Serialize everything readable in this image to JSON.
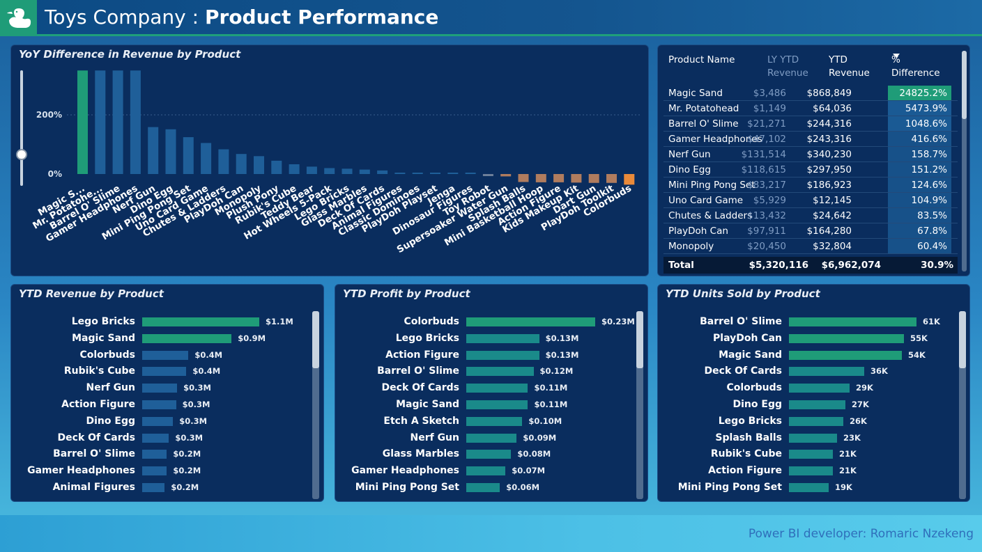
{
  "header": {
    "company": "Toys Company :",
    "page_title": "Product Performance",
    "logo_icon": "duck-logo-icon"
  },
  "colors": {
    "green": "#1f9c78",
    "blue_bar": "#1f5f99",
    "teal_bar": "#1a8a8a",
    "orange_bar": "#e98a3a",
    "tan_bar": "#b07c5e",
    "highlight_cell": "#1f9c78"
  },
  "yoy_chart": {
    "title": "YoY Difference in Revenue by Product"
  },
  "table": {
    "headers": {
      "product": "Product Name",
      "ly": "LY YTD Revenue",
      "ly_line1": "LY YTD",
      "ly_line2": "Revenue",
      "ytd_line1": "YTD",
      "ytd_line2": "Revenue",
      "pct_line1": "%",
      "pct_line2": "Difference"
    },
    "rows": [
      {
        "product": "Magic Sand",
        "ly": "$3,486",
        "ytd": "$868,849",
        "pct": "24825.2%"
      },
      {
        "product": "Mr. Potatohead",
        "ly": "$1,149",
        "ytd": "$64,036",
        "pct": "5473.9%"
      },
      {
        "product": "Barrel O' Slime",
        "ly": "$21,271",
        "ytd": "$244,316",
        "pct": "1048.6%"
      },
      {
        "product": "Gamer Headphones",
        "ly": "$47,102",
        "ytd": "$243,316",
        "pct": "416.6%"
      },
      {
        "product": "Nerf Gun",
        "ly": "$131,514",
        "ytd": "$340,230",
        "pct": "158.7%"
      },
      {
        "product": "Dino Egg",
        "ly": "$118,615",
        "ytd": "$297,950",
        "pct": "151.2%"
      },
      {
        "product": "Mini Ping Pong Set",
        "ly": "$83,217",
        "ytd": "$186,923",
        "pct": "124.6%"
      },
      {
        "product": "Uno Card Game",
        "ly": "$5,929",
        "ytd": "$12,145",
        "pct": "104.9%"
      },
      {
        "product": "Chutes & Ladders",
        "ly": "$13,432",
        "ytd": "$24,642",
        "pct": "83.5%"
      },
      {
        "product": "PlayDoh Can",
        "ly": "$97,911",
        "ytd": "$164,280",
        "pct": "67.8%"
      },
      {
        "product": "Monopoly",
        "ly": "$20,450",
        "ytd": "$32,804",
        "pct": "60.4%"
      }
    ],
    "total": {
      "label": "Total",
      "ly": "$5,320,116",
      "ytd": "$6,962,074",
      "pct": "30.9%"
    }
  },
  "revenue_panel": {
    "title": "YTD Revenue by Product"
  },
  "profit_panel": {
    "title": "YTD Profit by Product"
  },
  "units_panel": {
    "title": "YTD Units Sold by Product"
  },
  "footer": {
    "text": "Power BI developer: Romaric Nzekeng"
  },
  "chart_data": [
    {
      "type": "bar",
      "title": "YoY Difference in Revenue by Product",
      "ylabel": "",
      "yticks": [
        "0%",
        "200%"
      ],
      "ylim": [
        -50,
        350
      ],
      "categories": [
        "Magic S...",
        "Mr. Potatohe...",
        "Barrel O' Slime",
        "Gamer Headphones",
        "Nerf Gun",
        "Dino Egg",
        "Mini Ping Pong Set",
        "Uno Card Game",
        "Chutes & Ladders",
        "PlayDoh Can",
        "Monopoly",
        "Plush Pony",
        "Rubik's Cube",
        "Teddy Bear",
        "Hot Wheels 5-Pack",
        "Lego Bricks",
        "Glass Marbles",
        "Deck Of Cards",
        "Animal Figures",
        "Classic Dominoes",
        "PlayDoh Playset",
        "Jenga",
        "Dinosaur Figures",
        "Toy Robot",
        "Supersoaker Water Gun",
        "Splash Balls",
        "Mini Basketball Hoop",
        "Action Figure",
        "Kids Makeup Kit",
        "Dart Gun",
        "PlayDoh Toolkit",
        "Colorbuds"
      ],
      "values": [
        24825.2,
        5473.9,
        1048.6,
        416.6,
        158.7,
        151.2,
        124.6,
        104.9,
        83.5,
        67.8,
        60.4,
        45,
        33,
        25,
        20,
        18,
        15,
        12,
        3,
        2,
        1,
        1,
        1,
        -1,
        -8,
        -27,
        -28,
        -28,
        -29,
        -30,
        -30,
        -36
      ],
      "visible_clip_max": 350
    },
    {
      "type": "bar",
      "orientation": "horizontal",
      "title": "YTD Revenue by Product",
      "categories": [
        "Lego Bricks",
        "Magic Sand",
        "Colorbuds",
        "Rubik's Cube",
        "Nerf Gun",
        "Action Figure",
        "Dino Egg",
        "Deck Of Cards",
        "Barrel O' Slime",
        "Gamer Headphones",
        "Animal Figures"
      ],
      "values": [
        1.1,
        0.9,
        0.4,
        0.4,
        0.3,
        0.3,
        0.3,
        0.3,
        0.2,
        0.2,
        0.2
      ],
      "labels": [
        "$1.1M",
        "$0.9M",
        "$0.4M",
        "$0.4M",
        "$0.3M",
        "$0.3M",
        "$0.3M",
        "$0.3M",
        "$0.2M",
        "$0.2M",
        "$0.2M"
      ],
      "bar_values": [
        1.14,
        0.87,
        0.45,
        0.43,
        0.34,
        0.33,
        0.3,
        0.26,
        0.24,
        0.24,
        0.22
      ]
    },
    {
      "type": "bar",
      "orientation": "horizontal",
      "title": "YTD Profit by Product",
      "categories": [
        "Colorbuds",
        "Lego Bricks",
        "Action Figure",
        "Barrel O' Slime",
        "Deck Of Cards",
        "Magic Sand",
        "Etch A Sketch",
        "Nerf Gun",
        "Glass Marbles",
        "Gamer Headphones",
        "Mini Ping Pong Set"
      ],
      "values": [
        0.23,
        0.13,
        0.13,
        0.12,
        0.11,
        0.11,
        0.1,
        0.09,
        0.08,
        0.07,
        0.06
      ],
      "labels": [
        "$0.23M",
        "$0.13M",
        "$0.13M",
        "$0.12M",
        "$0.11M",
        "$0.11M",
        "$0.10M",
        "$0.09M",
        "$0.08M",
        "$0.07M",
        "$0.06M"
      ]
    },
    {
      "type": "bar",
      "orientation": "horizontal",
      "title": "YTD Units Sold by Product",
      "categories": [
        "Barrel O' Slime",
        "PlayDoh Can",
        "Magic Sand",
        "Deck Of Cards",
        "Colorbuds",
        "Dino Egg",
        "Lego Bricks",
        "Splash Balls",
        "Rubik's Cube",
        "Action Figure",
        "Mini Ping Pong Set"
      ],
      "values": [
        61,
        55,
        54,
        36,
        29,
        27,
        26,
        23,
        21,
        21,
        19
      ],
      "labels": [
        "61K",
        "55K",
        "54K",
        "36K",
        "29K",
        "27K",
        "26K",
        "23K",
        "21K",
        "21K",
        "19K"
      ]
    }
  ]
}
